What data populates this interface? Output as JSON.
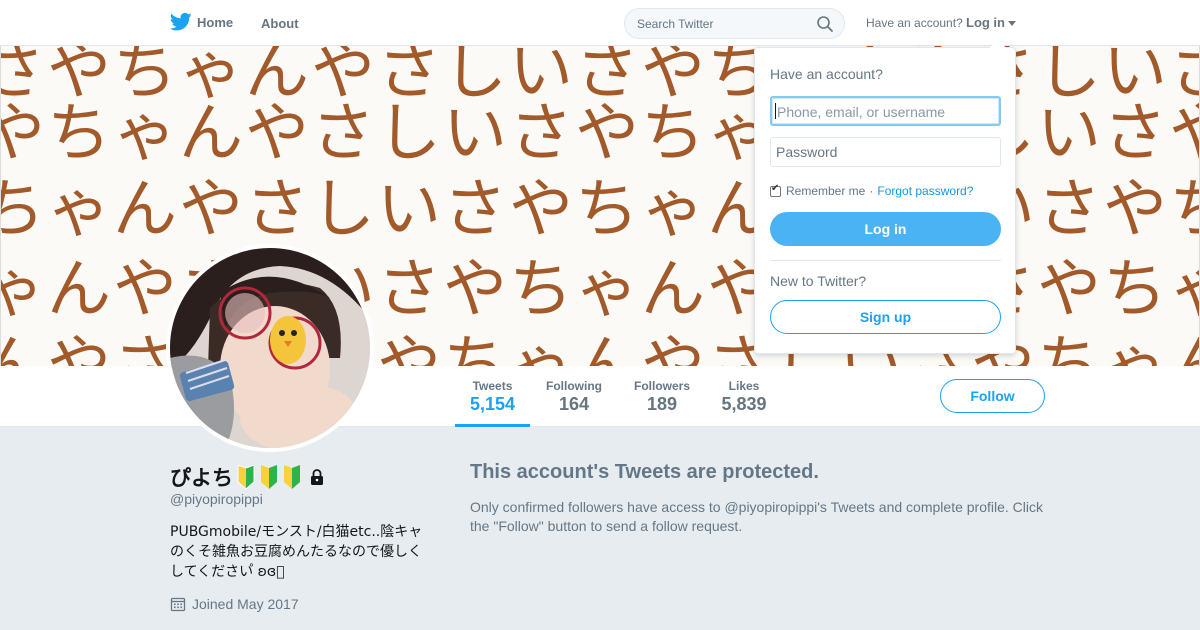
{
  "nav": {
    "home_label": "Home",
    "about_label": "About",
    "search_placeholder": "Search Twitter",
    "have_account": "Have an account?",
    "login_label": "Log in"
  },
  "banner": {
    "rows": [
      "さやちゃんやさしいさやちゃんやさしいさ",
      "やちゃんやさしいさやちゃんやさしいさや",
      "ちゃんやさしいさやちゃんやさしいさやち",
      "ゃんやさしいさやちゃんやさしいさやちゃ",
      "んやさしいさやちゃんやさしいさやちゃん"
    ],
    "text_color": "#a35a2a"
  },
  "stats": [
    {
      "label": "Tweets",
      "value": "5,154",
      "active": true
    },
    {
      "label": "Following",
      "value": "164",
      "active": false
    },
    {
      "label": "Followers",
      "value": "189",
      "active": false
    },
    {
      "label": "Likes",
      "value": "5,839",
      "active": false
    }
  ],
  "follow_label": "Follow",
  "profile": {
    "name": "ぴよち",
    "badge_icons": [
      "beginner-mark-icon",
      "beginner-mark-icon",
      "beginner-mark-icon"
    ],
    "lock_icon": "lock-icon",
    "handle": "@piyopiropippi",
    "bio": "PUBGmobile/モンスト/白猫etc..陰キャのくそ雑魚お豆腐めんたるなので優しくしてください゚ ʚ⁠ɞ゚",
    "joined": "Joined May 2017"
  },
  "protected": {
    "title": "This account's Tweets are protected.",
    "text": "Only confirmed followers have access to @piyopiropippi's Tweets and complete profile. Click the \"Follow\" button to send a follow request."
  },
  "login_dropdown": {
    "title": "Have an account?",
    "username_placeholder": "Phone, email, or username",
    "password_placeholder": "Password",
    "remember_label": "Remember me",
    "separator": "·",
    "forgot_label": "Forgot password?",
    "login_button": "Log in",
    "new_label": "New to Twitter?",
    "signup_button": "Sign up"
  },
  "colors": {
    "accent": "#1da1f2",
    "login_button_bg": "#4ab3f4",
    "page_bg": "#e6ecf0"
  }
}
